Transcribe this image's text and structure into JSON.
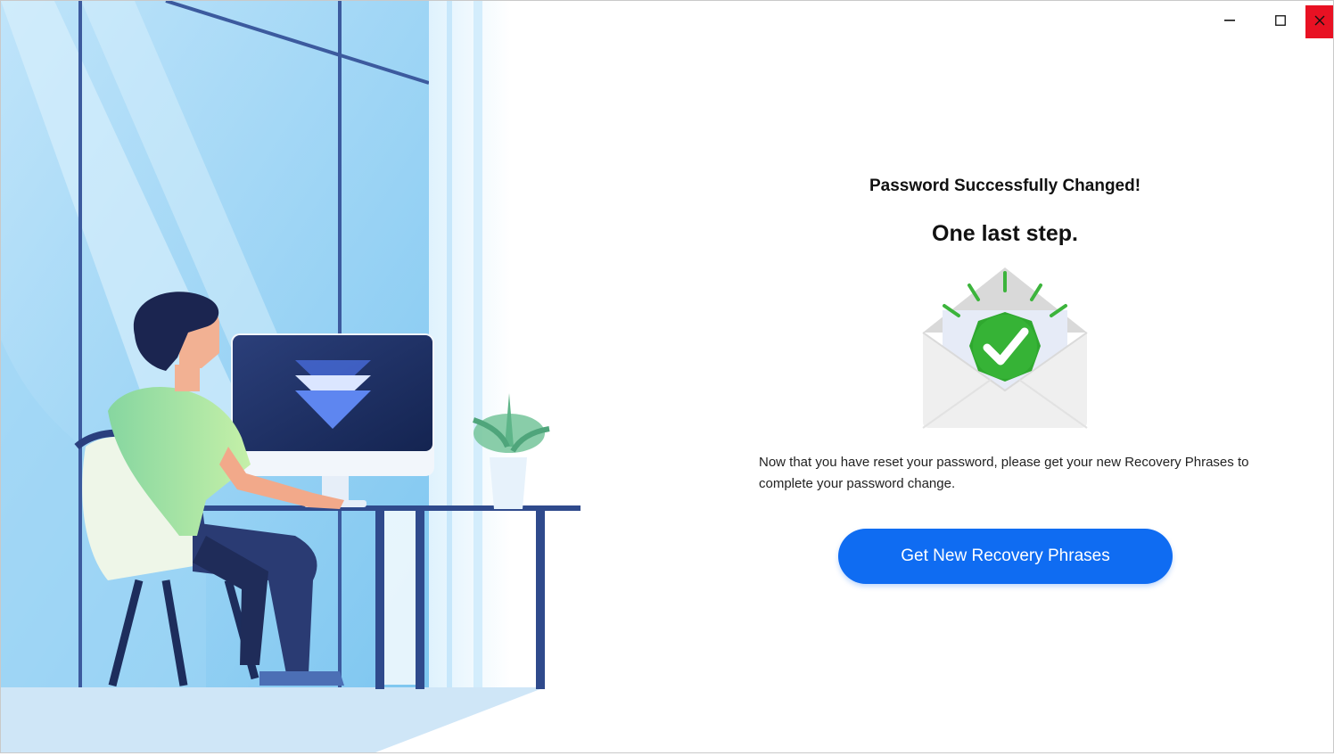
{
  "window": {
    "controls": {
      "minimize": "minimize-icon",
      "maximize": "maximize-icon",
      "close": "close-icon"
    },
    "close_color": "#e81123"
  },
  "main": {
    "subtitle": "Password Successfully Changed!",
    "title": "One last step.",
    "illustration_icon": "envelope-checkmark-icon",
    "message": "Now that you have reset your password, please get your new Recovery Phrases to complete your password change.",
    "cta_label": "Get New Recovery Phrases"
  },
  "colors": {
    "accent": "#0f6cf2",
    "success": "#2fa82f"
  }
}
